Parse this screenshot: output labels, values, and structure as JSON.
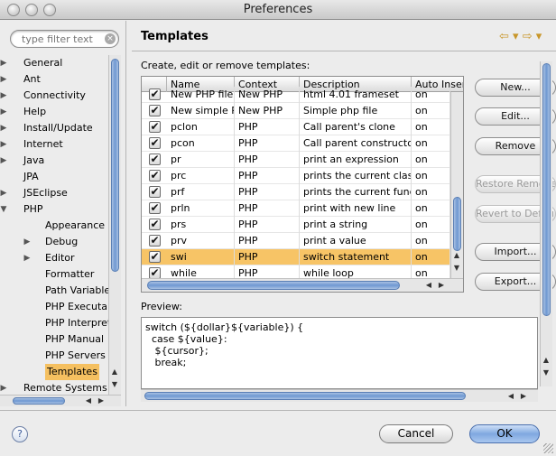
{
  "window": {
    "title": "Preferences"
  },
  "filter": {
    "placeholder": "type filter text"
  },
  "tree": [
    {
      "label": "General",
      "arrow": "▶",
      "indent": 0
    },
    {
      "label": "Ant",
      "arrow": "▶",
      "indent": 0
    },
    {
      "label": "Connectivity",
      "arrow": "▶",
      "indent": 0
    },
    {
      "label": "Help",
      "arrow": "▶",
      "indent": 0
    },
    {
      "label": "Install/Update",
      "arrow": "▶",
      "indent": 0
    },
    {
      "label": "Internet",
      "arrow": "▶",
      "indent": 0
    },
    {
      "label": "Java",
      "arrow": "▶",
      "indent": 0
    },
    {
      "label": "JPA",
      "arrow": "",
      "indent": 0
    },
    {
      "label": "JSEclipse",
      "arrow": "▶",
      "indent": 0
    },
    {
      "label": "PHP",
      "arrow": "▼",
      "indent": 0
    },
    {
      "label": "Appearance",
      "arrow": "",
      "indent": 1
    },
    {
      "label": "Debug",
      "arrow": "▶",
      "indent": 1
    },
    {
      "label": "Editor",
      "arrow": "▶",
      "indent": 1
    },
    {
      "label": "Formatter",
      "arrow": "",
      "indent": 1
    },
    {
      "label": "Path Variable",
      "arrow": "",
      "indent": 1
    },
    {
      "label": "PHP Executab",
      "arrow": "",
      "indent": 1
    },
    {
      "label": "PHP Interpret",
      "arrow": "",
      "indent": 1
    },
    {
      "label": "PHP Manual",
      "arrow": "",
      "indent": 1
    },
    {
      "label": "PHP Servers",
      "arrow": "",
      "indent": 1
    },
    {
      "label": "Templates",
      "arrow": "",
      "indent": 1,
      "selected": true
    },
    {
      "label": "Remote Systems",
      "arrow": "▶",
      "indent": 0
    }
  ],
  "page": {
    "heading": "Templates",
    "nav_back": "⇦ ▾",
    "nav_forward": "⇨ ▾",
    "description": "Create, edit or remove templates:",
    "columns": [
      "Name",
      "Context",
      "Description",
      "Auto Inser"
    ],
    "rows": [
      {
        "name": "New PHP file -",
        "context": "New PHP",
        "description": "html 4.01 frameset",
        "auto": "on",
        "checked": true
      },
      {
        "name": "New simple PI",
        "context": "New PHP",
        "description": "Simple php file",
        "auto": "on",
        "checked": true
      },
      {
        "name": "pclon",
        "context": "PHP",
        "description": "Call parent's clone",
        "auto": "on",
        "checked": true
      },
      {
        "name": "pcon",
        "context": "PHP",
        "description": "Call parent constructo",
        "auto": "on",
        "checked": true
      },
      {
        "name": "pr",
        "context": "PHP",
        "description": "print an expression",
        "auto": "on",
        "checked": true
      },
      {
        "name": "prc",
        "context": "PHP",
        "description": "prints the current clas",
        "auto": "on",
        "checked": true
      },
      {
        "name": "prf",
        "context": "PHP",
        "description": "prints the current func",
        "auto": "on",
        "checked": true
      },
      {
        "name": "prln",
        "context": "PHP",
        "description": "print with new line",
        "auto": "on",
        "checked": true
      },
      {
        "name": "prs",
        "context": "PHP",
        "description": "print a string",
        "auto": "on",
        "checked": true
      },
      {
        "name": "prv",
        "context": "PHP",
        "description": "print a value",
        "auto": "on",
        "checked": true
      },
      {
        "name": "swi",
        "context": "PHP",
        "description": "switch statement",
        "auto": "on",
        "checked": true,
        "selected": true
      },
      {
        "name": "while",
        "context": "PHP",
        "description": "while loop",
        "auto": "on",
        "checked": true
      }
    ],
    "buttons": {
      "new": "New...",
      "edit": "Edit...",
      "remove": "Remove",
      "restore_removed": "Restore Removed",
      "revert_default": "Revert to Default",
      "import": "Import...",
      "export": "Export..."
    },
    "preview_label": "Preview:",
    "preview_text": "switch (${dollar}${variable}) {\n  case ${value}:\n   ${cursor};\n   break;"
  },
  "dialog": {
    "help": "?",
    "cancel": "Cancel",
    "ok": "OK"
  }
}
